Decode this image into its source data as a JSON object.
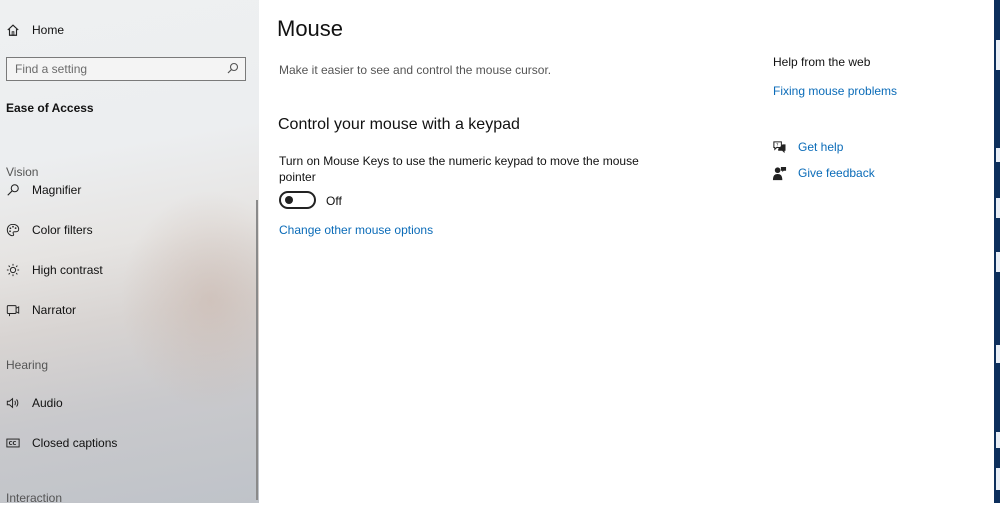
{
  "sidebar": {
    "home_label": "Home",
    "search_placeholder": "Find a setting",
    "category": "Ease of Access",
    "sections": {
      "vision": "Vision",
      "hearing": "Hearing",
      "interaction": "Interaction"
    },
    "items": {
      "magnifier": "Magnifier",
      "color_filters": "Color filters",
      "high_contrast": "High contrast",
      "narrator": "Narrator",
      "audio": "Audio",
      "closed_captions": "Closed captions"
    }
  },
  "main": {
    "title": "Mouse",
    "subtitle": "Make it easier to see and control the mouse cursor.",
    "section_title": "Control your mouse with a keypad",
    "mouse_keys_description": "Turn on Mouse Keys to use the numeric keypad to move the mouse pointer",
    "toggle_state": "Off",
    "change_link": "Change other mouse options"
  },
  "help": {
    "title": "Help from the web",
    "fixing_link": "Fixing mouse problems",
    "get_help": "Get help",
    "give_feedback": "Give feedback"
  },
  "colors": {
    "link": "#0a6bb8",
    "right_strip": "#0d2f5c"
  }
}
